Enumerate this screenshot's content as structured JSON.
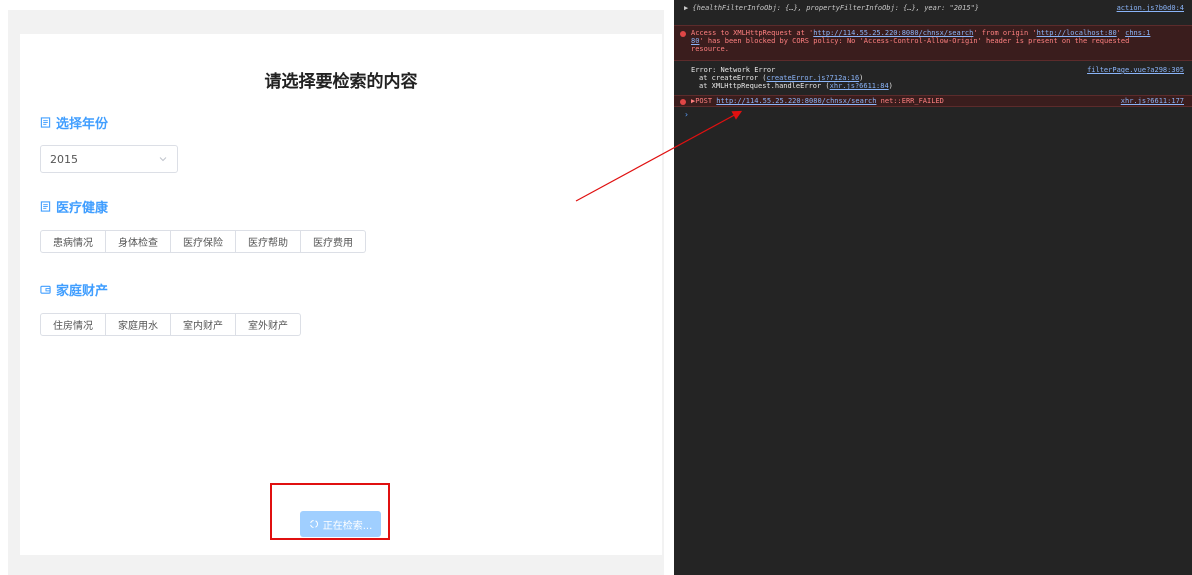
{
  "filter_page": {
    "title": "请选择要检索的内容",
    "year_section": {
      "title": "选择年份",
      "selected": "2015"
    },
    "health_section": {
      "title": "医疗健康",
      "options": [
        "患病情况",
        "身体检查",
        "医疗保险",
        "医疗帮助",
        "医疗费用"
      ]
    },
    "property_section": {
      "title": "家庭财产",
      "options": [
        "住房情况",
        "家庭用水",
        "室内财产",
        "室外财产"
      ]
    },
    "search_button_label": "正在检索..."
  },
  "console": {
    "log_object": {
      "text": "▶ {healthFilterInfoObj: {…}, propertyFilterInfoObj: {…}, year: \"2015\"}",
      "source": "action.js?b0d0:4"
    },
    "cors_error": {
      "line1_prefix": "Access to XMLHttpRequest at '",
      "line1_link": "http://114.55.25.220:8080/chnsx/search",
      "line1_mid": "' from origin '",
      "line1_origin": "http://localhost:80",
      "line1_source": "chns:1",
      "line2_source_tail": "80",
      "line2_text": "' has been blocked by CORS policy: No 'Access-Control-Allow-Origin' header is present on the requested",
      "line3_text": "resource."
    },
    "network_error": {
      "title": "Error: Network Error",
      "source": "filterPage.vue?a298:305",
      "frame1_prefix": "at createError (",
      "frame1_link": "createError.js?712a:16",
      "frame1_suffix": ")",
      "frame2_prefix": "at XMLHttpRequest.handleError (",
      "frame2_link": "xhr.js?6611:84",
      "frame2_suffix": ")"
    },
    "post_error": {
      "prefix": "▶POST ",
      "link": "http://114.55.25.220:8080/chnsx/search",
      "suffix": " net::ERR_FAILED",
      "source": "xhr.js?6611:177"
    },
    "prompt": "›"
  },
  "colors": {
    "accent": "#409eff",
    "annotation": "#e01010",
    "error": "#ff8080"
  },
  "icons": {
    "section_year": "document-icon",
    "section_health": "document-icon",
    "section_property": "wallet-icon",
    "search_button": "loading-icon"
  }
}
